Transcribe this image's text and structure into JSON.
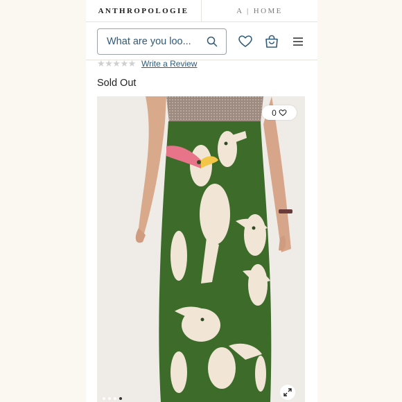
{
  "brand": {
    "active_label": "ANTHROPOLOGIE",
    "home_label": "A | HOME"
  },
  "search": {
    "placeholder": "What are you loo..."
  },
  "header_icons": [
    "heart-icon",
    "shopping-bag-icon",
    "menu-icon"
  ],
  "rating": {
    "stars": "★★★★★",
    "review_link": "Write a Review"
  },
  "product": {
    "status": "Sold Out",
    "like_count": "0"
  },
  "gallery": {
    "dot_count": 4,
    "active_dot": 3
  },
  "colors": {
    "accent": "#2e5a78",
    "skirt_green": "#3c6b2a",
    "print_cream": "#f1e6d6",
    "beak_pink": "#e8748a"
  }
}
